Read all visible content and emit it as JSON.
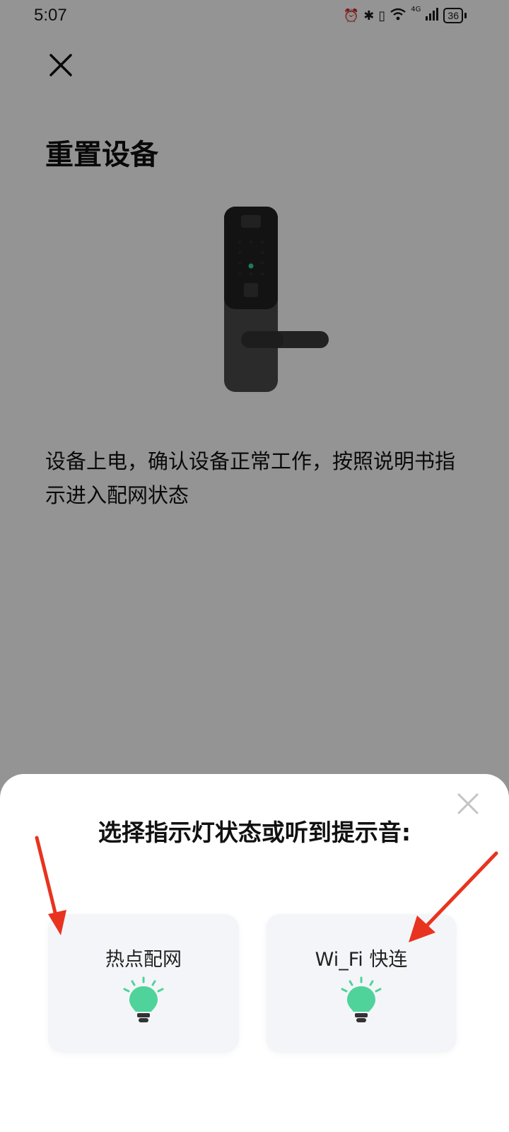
{
  "status_bar": {
    "time": "5:07",
    "network": "4G",
    "battery": "36"
  },
  "page": {
    "title": "重置设备",
    "instruction": "设备上电，确认设备正常工作，按照说明书指示进入配网状态"
  },
  "sheet": {
    "title": "选择指示灯状态或听到提示音:",
    "options": [
      {
        "label": "热点配网",
        "icon": "lightbulb-icon"
      },
      {
        "label": "Wi_Fi 快连",
        "icon": "lightbulb-icon"
      }
    ]
  },
  "colors": {
    "bulb": "#4fd39a",
    "arrow": "#e8331f",
    "overlay": "#959595"
  }
}
